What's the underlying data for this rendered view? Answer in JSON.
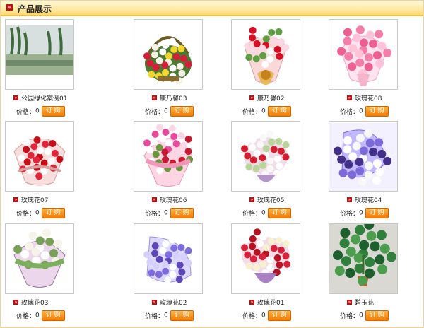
{
  "section": {
    "title": "产品展示",
    "mark": "»"
  },
  "price_label": "价格：",
  "order_label": "订 购",
  "products": [
    {
      "name": "公园绿化案例01",
      "price": "0",
      "image": "park-photo"
    },
    {
      "name": "康乃馨03",
      "price": "0",
      "image": "carnation-basket"
    },
    {
      "name": "康乃馨02",
      "price": "0",
      "image": "carnation-bouquet"
    },
    {
      "name": "玫瑰花08",
      "price": "0",
      "image": "pink-rose-bouquet"
    },
    {
      "name": "玫瑰花07",
      "price": "0",
      "image": "red-rose-wrapped"
    },
    {
      "name": "玫瑰花06",
      "price": "0",
      "image": "lily-rose-bouquet"
    },
    {
      "name": "玫瑰花05",
      "price": "0",
      "image": "white-lily-rose"
    },
    {
      "name": "玫瑰花04",
      "price": "0",
      "image": "purple-white-bouquet"
    },
    {
      "name": "玫瑰花03",
      "price": "0",
      "image": "white-rose-wrapped"
    },
    {
      "name": "玫瑰花02",
      "price": "0",
      "image": "purple-flower-bouquet"
    },
    {
      "name": "玫瑰花01",
      "price": "0",
      "image": "red-rose-bouquet"
    },
    {
      "name": "碧玉花",
      "price": "0",
      "image": "potted-plant"
    }
  ],
  "colors": {
    "brand_red": "#c30d10",
    "button_orange": "#f57a00",
    "header_gold": "#f2c04a"
  }
}
